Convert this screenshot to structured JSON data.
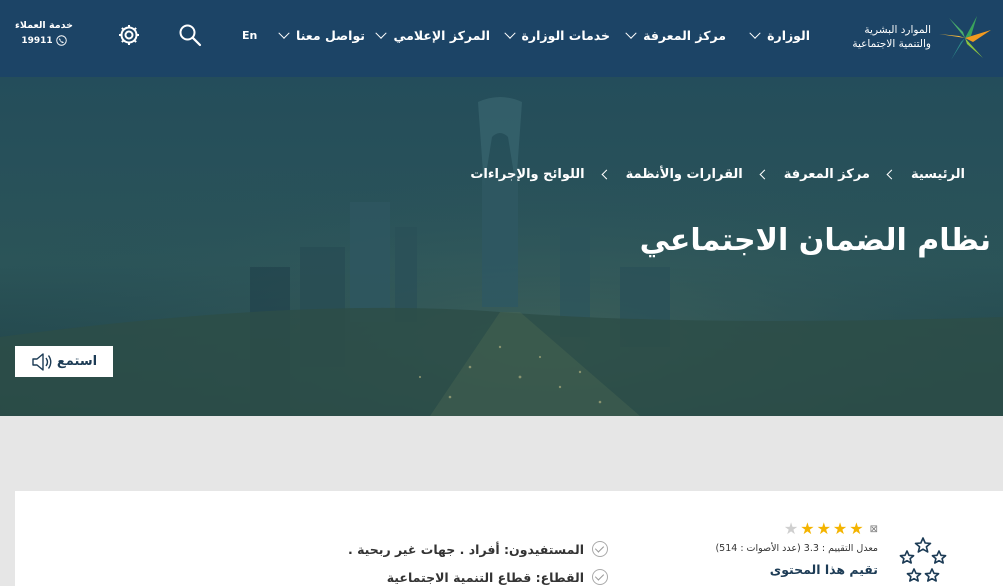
{
  "header": {
    "logo": {
      "line1": "الموارد البشرية",
      "line2": "والتنمية الاجتماعية"
    },
    "nav": [
      {
        "label": "الوزارة"
      },
      {
        "label": "مركز المعرفة"
      },
      {
        "label": "خدمات الوزارة"
      },
      {
        "label": "المركز الإعلامي"
      },
      {
        "label": "تواصل معنا"
      }
    ],
    "lang_label": "En",
    "customer_service": {
      "label": "خدمة العملاء",
      "number": "19911"
    }
  },
  "hero": {
    "breadcrumb": [
      "الرئيسية",
      "مركز المعرفة",
      "القرارات والأنظمة",
      "اللوائح والإجراءات"
    ],
    "title": "نظام الضمان الاجتماعي",
    "listen_label": "استمع"
  },
  "rating": {
    "stars_filled": 4,
    "stars_total": 5,
    "info": "معدل التقييم : 3.3 (عدد الأصوات : 514)",
    "rate_label": "تقيم هذا المحتوى"
  },
  "info_list": [
    {
      "text": "المستفيدون: أفراد . جهات غير ربحية ."
    },
    {
      "text": "القطاع: قطاع التنمية الاجتماعية"
    }
  ],
  "colors": {
    "header_bg": "#1c4466",
    "star_on": "#f4b400",
    "accent_green": "#3aa35b",
    "accent_orange": "#f29a1f"
  }
}
